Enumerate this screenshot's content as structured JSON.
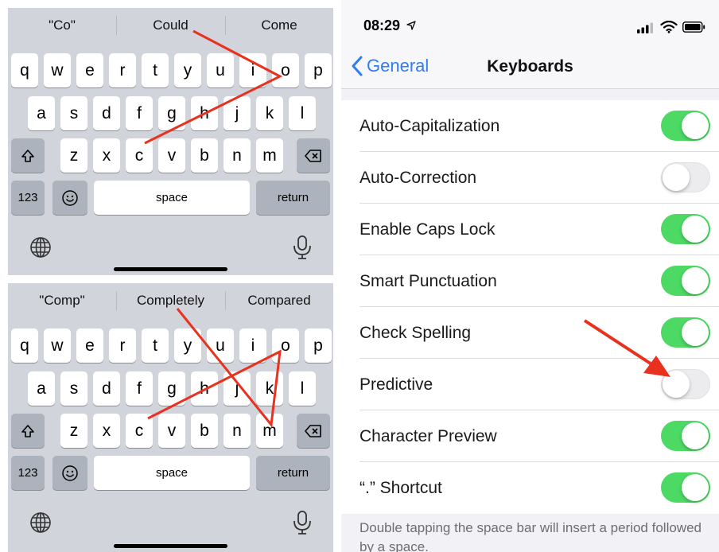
{
  "keyboard_top": {
    "suggestions": [
      "\"Co\"",
      "Could",
      "Come"
    ],
    "rows": [
      [
        "q",
        "w",
        "e",
        "r",
        "t",
        "y",
        "u",
        "i",
        "o",
        "p"
      ],
      [
        "a",
        "s",
        "d",
        "f",
        "g",
        "h",
        "j",
        "k",
        "l"
      ],
      [
        "z",
        "x",
        "c",
        "v",
        "b",
        "n",
        "m"
      ]
    ],
    "numbers_label": "123",
    "space_label": "space",
    "return_label": "return"
  },
  "keyboard_bottom": {
    "suggestions": [
      "\"Comp\"",
      "Completely",
      "Compared"
    ],
    "rows": [
      [
        "q",
        "w",
        "e",
        "r",
        "t",
        "y",
        "u",
        "i",
        "o",
        "p"
      ],
      [
        "a",
        "s",
        "d",
        "f",
        "g",
        "h",
        "j",
        "k",
        "l"
      ],
      [
        "z",
        "x",
        "c",
        "v",
        "b",
        "n",
        "m"
      ]
    ],
    "numbers_label": "123",
    "space_label": "space",
    "return_label": "return"
  },
  "settings": {
    "status": {
      "time": "08:29"
    },
    "nav": {
      "back_label": "General",
      "title": "Keyboards"
    },
    "rows": [
      {
        "label": "Auto-Capitalization",
        "on": true
      },
      {
        "label": "Auto-Correction",
        "on": false
      },
      {
        "label": "Enable Caps Lock",
        "on": true
      },
      {
        "label": "Smart Punctuation",
        "on": true
      },
      {
        "label": "Check Spelling",
        "on": true
      },
      {
        "label": "Predictive",
        "on": false
      },
      {
        "label": "Character Preview",
        "on": true
      },
      {
        "label": "“.” Shortcut",
        "on": true
      }
    ],
    "footer": "Double tapping the space bar will insert a period followed by a space."
  },
  "colors": {
    "annotation_red": "#e8321f",
    "toggle_on": "#4cd964",
    "link_blue": "#2f7cf6"
  }
}
